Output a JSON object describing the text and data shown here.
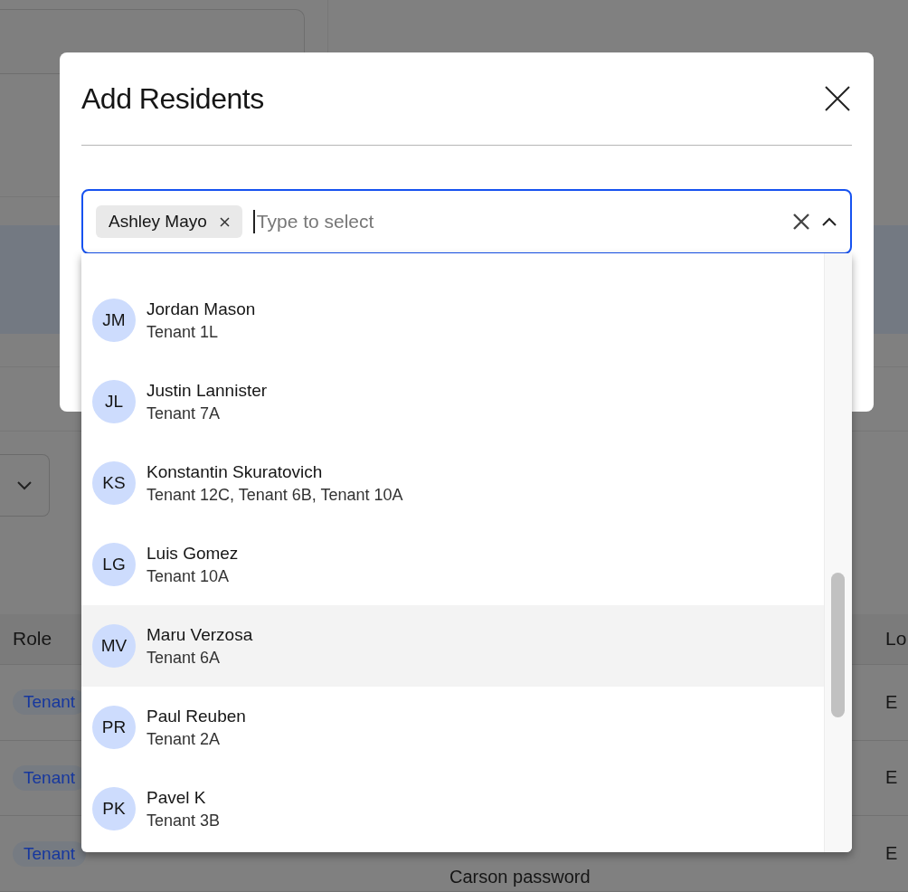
{
  "background_page": {
    "filter_dropdown": {
      "open": false
    },
    "table": {
      "columns": [
        "Role",
        "Lo"
      ],
      "rows": [
        {
          "role": "Tenant",
          "column_2": "",
          "column_3": "E"
        },
        {
          "role": "Tenant",
          "column_2": "",
          "column_3": "E"
        },
        {
          "role": "Tenant",
          "column_2": "Carson password",
          "column_3": "E"
        }
      ]
    }
  },
  "modal": {
    "title": "Add Residents",
    "select": {
      "chips": [
        {
          "label": "Ashley Mayo"
        }
      ],
      "placeholder": "Type to select",
      "expanded": true
    },
    "options": [
      {
        "initials": "JM",
        "name": "Jordan Mason",
        "units": "Tenant 1L",
        "highlighted": false
      },
      {
        "initials": "JL",
        "name": "Justin Lannister",
        "units": "Tenant 7A",
        "highlighted": false
      },
      {
        "initials": "KS",
        "name": "Konstantin Skuratovich",
        "units": "Tenant 12C, Tenant 6B, Tenant 10A",
        "highlighted": false
      },
      {
        "initials": "LG",
        "name": "Luis Gomez",
        "units": "Tenant 10A",
        "highlighted": false
      },
      {
        "initials": "MV",
        "name": "Maru Verzosa",
        "units": "Tenant 6A",
        "highlighted": true
      },
      {
        "initials": "PR",
        "name": "Paul Reuben",
        "units": "Tenant 2A",
        "highlighted": false
      },
      {
        "initials": "PK",
        "name": "Pavel K",
        "units": "Tenant 3B",
        "highlighted": false
      }
    ]
  }
}
